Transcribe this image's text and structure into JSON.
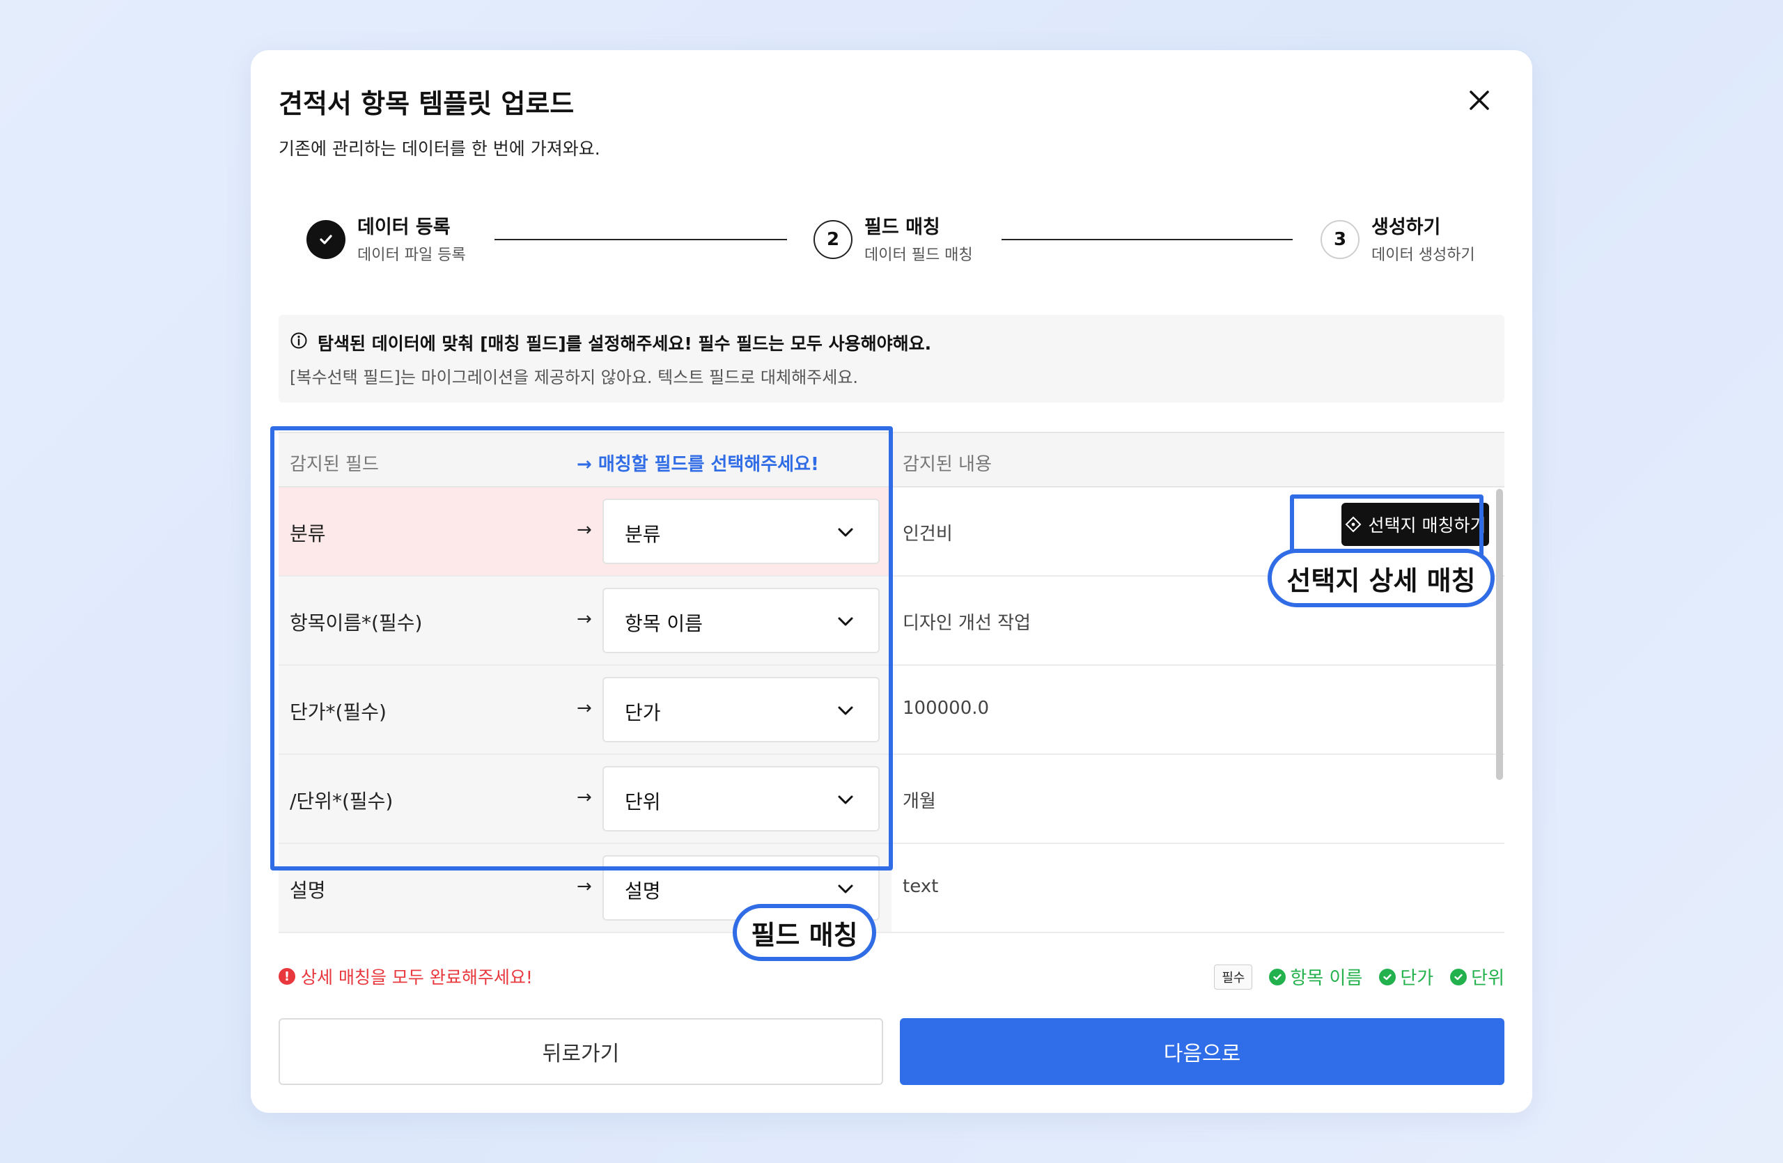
{
  "modal": {
    "title": "견적서 항목 템플릿 업로드",
    "subtitle": "기존에 관리하는 데이터를 한 번에 가져와요."
  },
  "steps": [
    {
      "number": "",
      "title": "데이터 등록",
      "sub": "데이터 파일 등록",
      "state": "done"
    },
    {
      "number": "2",
      "title": "필드 매칭",
      "sub": "데이터 필드 매칭",
      "state": "current"
    },
    {
      "number": "3",
      "title": "생성하기",
      "sub": "데이터 생성하기",
      "state": "todo"
    }
  ],
  "info": {
    "line1": "탐색된 데이터에 맞춰 [매칭 필드]를 설정해주세요! 필수 필드는 모두 사용해야해요.",
    "line2": "[복수선택 필드]는 마이그레이션을 제공하지 않아요. 텍스트 필드로 대체해주세요."
  },
  "table": {
    "header_detected": "감지된 필드",
    "header_match": "→ 매칭할 필드를 선택해주세요!",
    "header_content": "감지된 내용",
    "rows": [
      {
        "field": "분류",
        "arrow": "→",
        "selected": "분류",
        "content": "인건비"
      },
      {
        "field": "항목이름*(필수)",
        "arrow": "→",
        "selected": "항목 이름",
        "content": "디자인 개선 작업"
      },
      {
        "field": "단가*(필수)",
        "arrow": "→",
        "selected": "단가",
        "content": "100000.0"
      },
      {
        "field": "/단위*(필수)",
        "arrow": "→",
        "selected": "단위",
        "content": "개월"
      },
      {
        "field": "설명",
        "arrow": "→",
        "selected": "설명",
        "content": "text"
      }
    ],
    "match_button": "선택지 매칭하기"
  },
  "callouts": {
    "field_match": "필드 매칭",
    "detail_match": "선택지 상세 매칭"
  },
  "footer": {
    "error": "상세 매칭을 모두 완료해주세요!",
    "error_icon": "!",
    "required_tag": "필수",
    "required_items": [
      "항목 이름",
      "단가",
      "단위"
    ],
    "back": "뒤로가기",
    "next": "다음으로"
  },
  "colors": {
    "accent": "#2f6ce5",
    "error": "#e8383d",
    "success": "#22b14c"
  }
}
